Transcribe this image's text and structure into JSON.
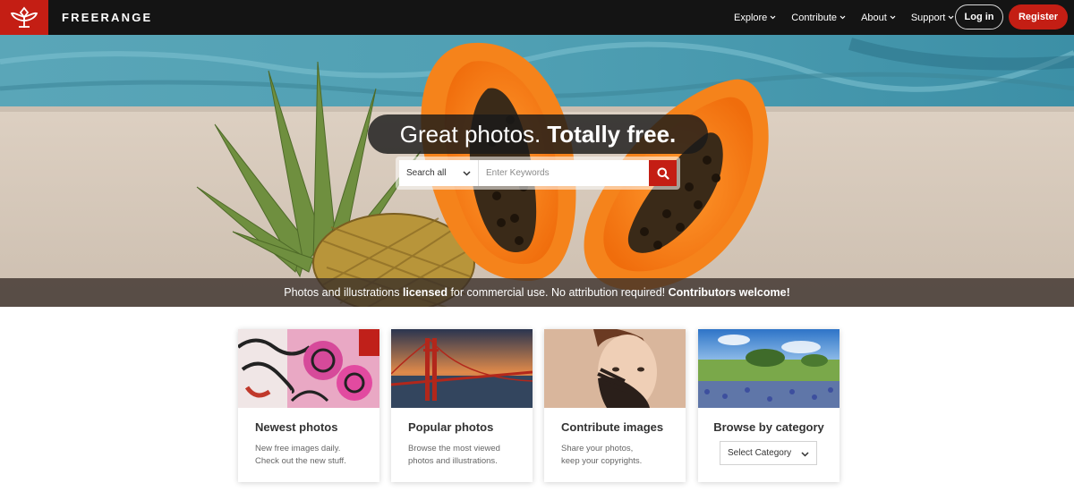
{
  "brand": {
    "name": "FREERANGE",
    "logo_icon": "freerange-leaf-logo",
    "accent_color": "#c41e14"
  },
  "nav": {
    "items": [
      {
        "label": "Explore"
      },
      {
        "label": "Contribute"
      },
      {
        "label": "About"
      },
      {
        "label": "Support"
      }
    ],
    "login_label": "Log in",
    "register_label": "Register"
  },
  "hero": {
    "headline_light": "Great photos.",
    "headline_bold": "Totally free.",
    "search": {
      "scope_value": "Search all",
      "placeholder": "Enter Keywords",
      "button_icon": "search-icon"
    },
    "tagline": {
      "part1": "Photos and illustrations ",
      "part2_bold": "licensed",
      "part3": " for commercial use. No attribution required! ",
      "part4_bold": "Contributors welcome!"
    }
  },
  "cards": [
    {
      "title": "Newest photos",
      "desc_line1": "New free images daily.",
      "desc_line2": "Check out the new stuff."
    },
    {
      "title": "Popular photos",
      "desc_line1": "Browse the most viewed",
      "desc_line2": "photos and illustrations."
    },
    {
      "title": "Contribute images",
      "desc_line1": "Share your photos,",
      "desc_line2": "keep your copyrights."
    },
    {
      "title": "Browse by category",
      "select_value": "Select Category"
    }
  ]
}
